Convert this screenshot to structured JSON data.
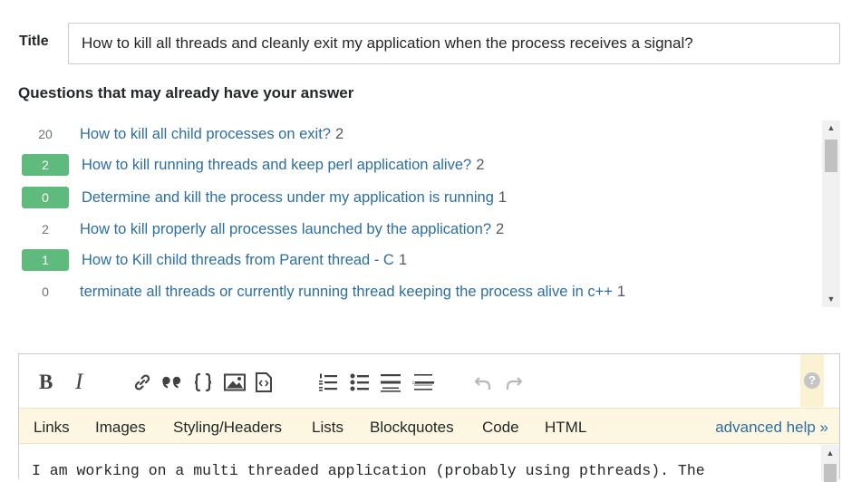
{
  "title_field": {
    "label": "Title",
    "value": "How to kill all threads and cleanly exit my application when the process receives a signal?"
  },
  "similar_questions": {
    "heading": "Questions that may already have your answer",
    "items": [
      {
        "score": "20",
        "accepted": false,
        "title": "How to kill all child processes on exit?",
        "count": "2"
      },
      {
        "score": "2",
        "accepted": true,
        "title": "How to kill running threads and keep perl application alive?",
        "count": "2"
      },
      {
        "score": "0",
        "accepted": true,
        "title": "Determine and kill the process under my application is running",
        "count": "1"
      },
      {
        "score": "2",
        "accepted": false,
        "title": "How to kill properly all processes launched by the application?",
        "count": "2"
      },
      {
        "score": "1",
        "accepted": true,
        "title": "How to Kill child threads from Parent thread - C",
        "count": "1"
      },
      {
        "score": "0",
        "accepted": false,
        "title": "terminate all threads or currently running thread keeping the process alive in c++",
        "count": "1"
      }
    ]
  },
  "editor": {
    "toolbar": {
      "bold": "B",
      "italic": "I",
      "buttons": [
        "link-icon",
        "blockquote-icon",
        "code-icon",
        "image-icon",
        "snippet-icon",
        "numbered-list-icon",
        "bulleted-list-icon",
        "heading-icon",
        "horizontal-rule-icon",
        "undo-icon",
        "redo-icon",
        "help-icon"
      ],
      "help_symbol": "?"
    },
    "help_tabs": [
      "Links",
      "Images",
      "Styling/Headers",
      "Lists",
      "Blockquotes",
      "Code",
      "HTML"
    ],
    "advanced_help": "advanced help »",
    "body_text": "I am working on a multi threaded application (probably using pthreads). The"
  },
  "colors": {
    "link": "#2c6ea3",
    "accepted_badge": "#5fba7d",
    "help_bar": "#fdf7e2"
  }
}
